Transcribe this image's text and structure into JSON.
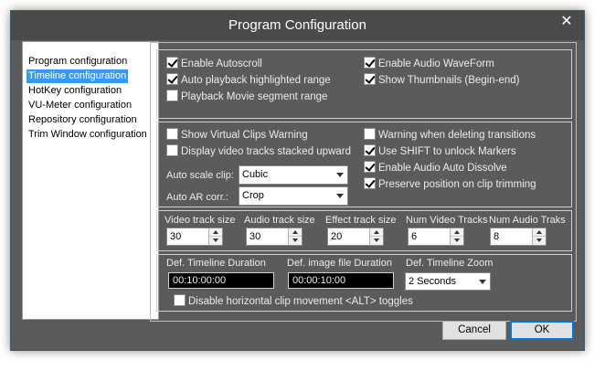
{
  "window": {
    "title": "Program Configuration",
    "close_glyph": "✕"
  },
  "sidebar": {
    "items": [
      {
        "label": "Program configuration"
      },
      {
        "label": "Timeline configuration",
        "selected": true
      },
      {
        "label": "HotKey configuration"
      },
      {
        "label": "VU-Meter configuration"
      },
      {
        "label": "Repository configuration"
      },
      {
        "label": "Trim Window configuration"
      }
    ]
  },
  "playback_group": {
    "enable_autoscroll": {
      "label": "Enable Autoscroll",
      "checked": true
    },
    "auto_playback": {
      "label": "Auto playback highlighted range",
      "checked": true
    },
    "playback_movie": {
      "label": "Playback Movie segment range",
      "checked": false
    },
    "enable_waveform": {
      "label": "Enable Audio WaveForm",
      "checked": true
    },
    "show_thumbnails": {
      "label": "Show Thumbnails (Begin-end)",
      "checked": true
    }
  },
  "clips_group": {
    "virtual_clips_warning": {
      "label": "Show Virtual Clips Warning",
      "checked": false
    },
    "stacked_upward": {
      "label": "Display video tracks stacked upward",
      "checked": false
    },
    "warning_delete": {
      "label": "Warning when deleting transitions",
      "checked": false
    },
    "shift_unlock": {
      "label": "Use SHIFT to unlock Markers",
      "checked": true
    },
    "auto_dissolve": {
      "label": "Enable Audio Auto Dissolve",
      "checked": true
    },
    "preserve_position": {
      "label": "Preserve position on clip trimming",
      "checked": true
    },
    "auto_scale_label": "Auto scale clip:",
    "auto_scale_value": "Cubic",
    "auto_ar_label": "Auto AR corr.:",
    "auto_ar_value": "Crop"
  },
  "tracks_group": {
    "video_track_size": {
      "label": "Video track size",
      "value": "30"
    },
    "audio_track_size": {
      "label": "Audio track size",
      "value": "30"
    },
    "effect_track_size": {
      "label": "Effect track size",
      "value": "20"
    },
    "num_video_tracks": {
      "label": "Num Video Tracks",
      "value": "6"
    },
    "num_audio_tracks": {
      "label": "Num Audio Traks",
      "value": "8"
    }
  },
  "duration_group": {
    "timeline_duration": {
      "label": "Def. Timeline Duration",
      "value": "00:10:00:00"
    },
    "image_duration": {
      "label": "Def. image file Duration",
      "value": "00:00:10:00"
    },
    "timeline_zoom": {
      "label": "Def. Timeline Zoom",
      "value": "2 Seconds"
    },
    "disable_horizontal": {
      "label": "Disable horizontal clip movement  <ALT> toggles",
      "checked": false
    }
  },
  "footer": {
    "cancel_label": "Cancel",
    "ok_label": "OK"
  }
}
